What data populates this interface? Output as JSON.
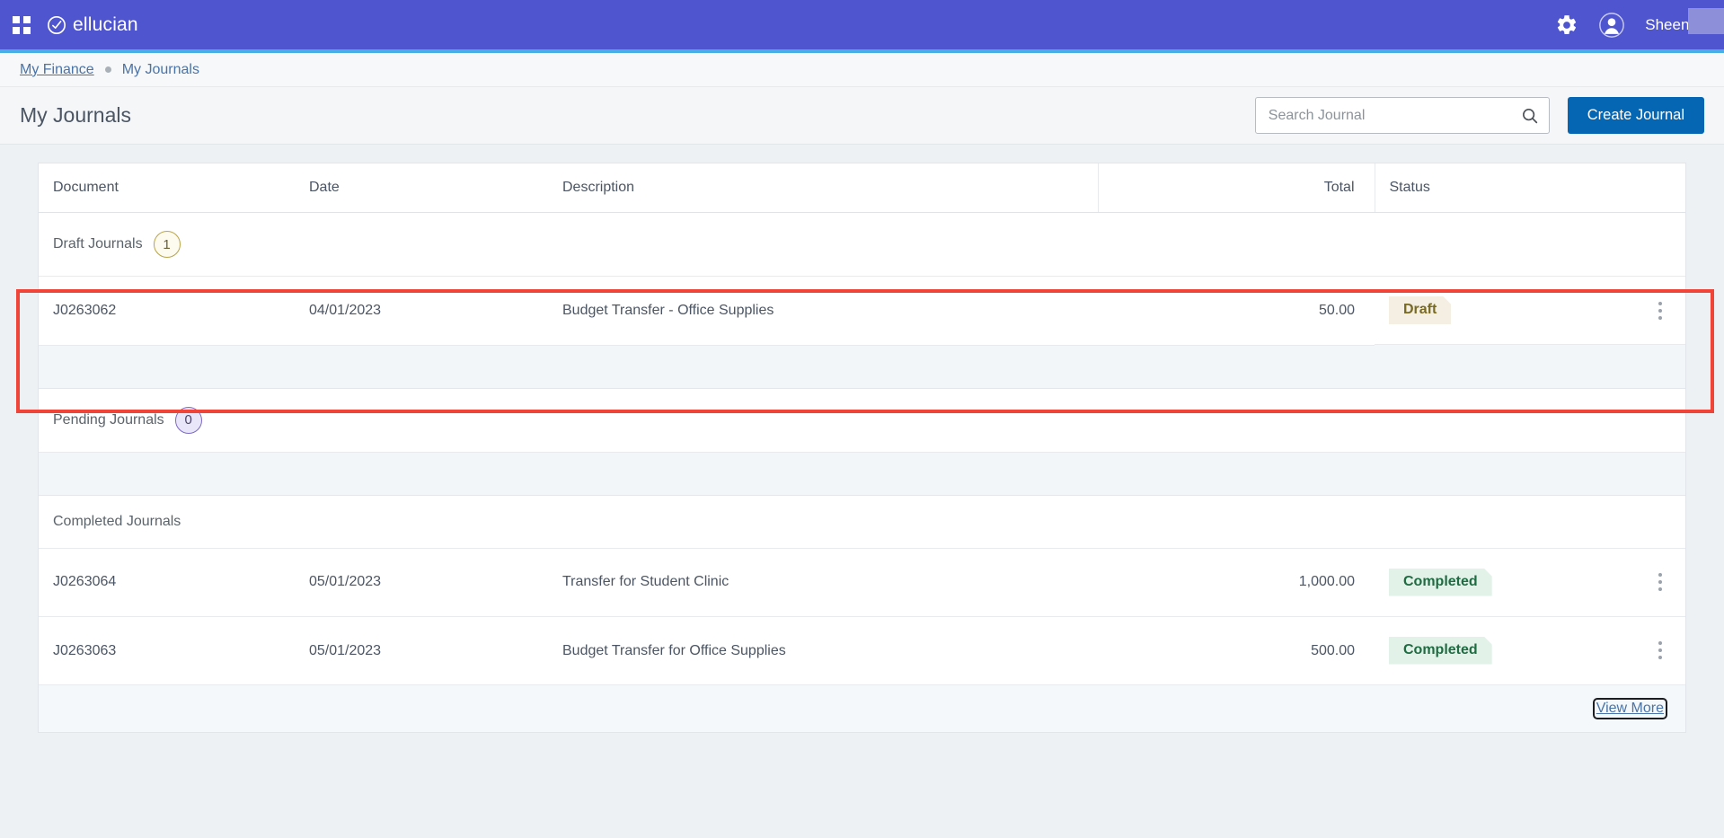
{
  "appbar": {
    "grid_icon": "grid-apps-icon",
    "brand": "ellucian",
    "gear_icon": "gear-icon",
    "avatar_icon": "user-avatar-icon",
    "user_name": "Sheena A"
  },
  "breadcrumb": {
    "parent": "My Finance",
    "current": "My Journals"
  },
  "titlebar": {
    "page_title": "My Journals",
    "search_placeholder": "Search Journal",
    "search_value": "",
    "search_icon": "search-icon",
    "create_button": "Create Journal"
  },
  "table": {
    "headers": {
      "document": "Document",
      "date": "Date",
      "description": "Description",
      "total": "Total",
      "status": "Status"
    },
    "sections": [
      {
        "label": "Draft Journals",
        "count": "1",
        "rows": [
          {
            "document": "J0263062",
            "date": "04/01/2023",
            "description": "Budget Transfer - Office Supplies",
            "total": "50.00",
            "status": "Draft"
          }
        ]
      },
      {
        "label": "Pending Journals",
        "count": "0",
        "rows": []
      },
      {
        "label": "Completed Journals",
        "count": "",
        "rows": [
          {
            "document": "J0263064",
            "date": "05/01/2023",
            "description": "Transfer for Student Clinic",
            "total": "1,000.00",
            "status": "Completed"
          },
          {
            "document": "J0263063",
            "date": "05/01/2023",
            "description": "Budget Transfer for Office Supplies",
            "total": "500.00",
            "status": "Completed"
          }
        ]
      }
    ],
    "footer_link": "View More",
    "row_menu_icon": "kebab-menu-icon"
  },
  "colors": {
    "appbar": "#4f55ce",
    "appbar_underline": "#46b0e6",
    "primary_button": "#0566b4",
    "link": "#4a73a8",
    "draft_badge_bg": "#f4efe2",
    "draft_badge_text": "#796a23",
    "completed_badge_bg": "#e3f2e8",
    "completed_badge_text": "#1f6b42",
    "annotation": "#f04438"
  }
}
